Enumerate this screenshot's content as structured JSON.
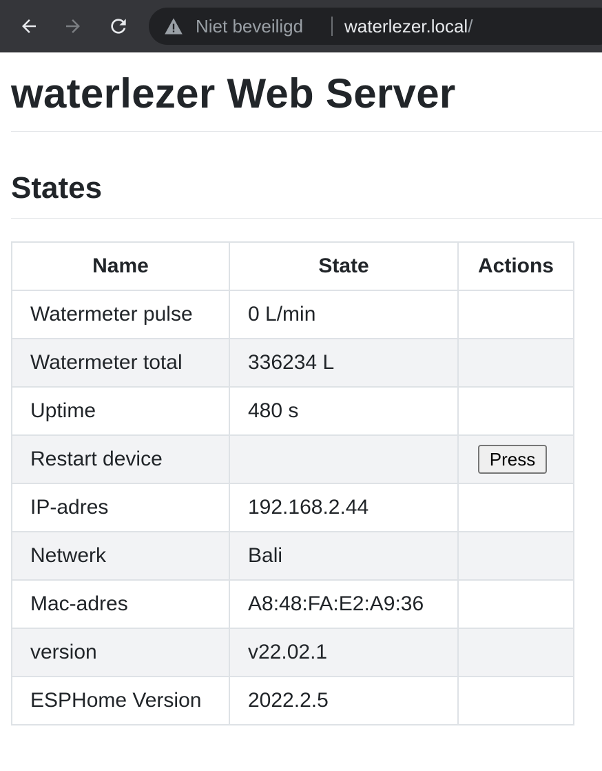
{
  "browser": {
    "security_label": "Niet beveiligd",
    "url_host": "waterlezer.local",
    "url_path": "/"
  },
  "page": {
    "title": "waterlezer Web Server",
    "section": "States"
  },
  "table": {
    "headers": [
      "Name",
      "State",
      "Actions"
    ],
    "rows": [
      {
        "name": "Watermeter pulse",
        "state": "0 L/min",
        "action": ""
      },
      {
        "name": "Watermeter total",
        "state": "336234 L",
        "action": ""
      },
      {
        "name": "Uptime",
        "state": "480 s",
        "action": ""
      },
      {
        "name": "Restart device",
        "state": "",
        "action": "Press"
      },
      {
        "name": "IP-adres",
        "state": "192.168.2.44",
        "action": ""
      },
      {
        "name": "Netwerk",
        "state": "Bali",
        "action": ""
      },
      {
        "name": "Mac-adres",
        "state": "A8:48:FA:E2:A9:36",
        "action": ""
      },
      {
        "name": "version",
        "state": "v22.02.1",
        "action": ""
      },
      {
        "name": "ESPHome Version",
        "state": "2022.2.5",
        "action": ""
      }
    ]
  },
  "icons": {
    "back": "arrow-left-icon",
    "forward": "arrow-right-icon",
    "reload": "reload-icon",
    "security": "warning-triangle-icon"
  },
  "colors": {
    "toolbar": "#35363a",
    "omnibox": "#202124",
    "table_border": "#dee2e6",
    "stripe": "#f2f3f5"
  }
}
